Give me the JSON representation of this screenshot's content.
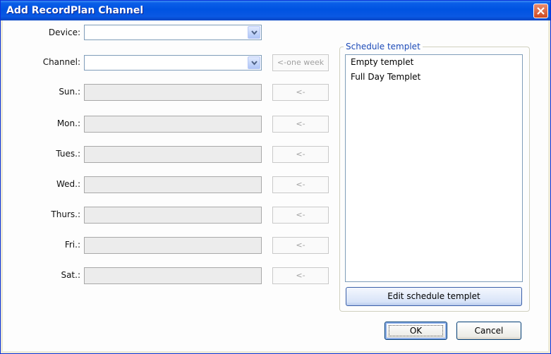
{
  "window": {
    "title": "Add RecordPlan Channel"
  },
  "form": {
    "device_label": "Device:",
    "channel_label": "Channel:",
    "device_value": "",
    "channel_value": "",
    "one_week_button": "<-one week"
  },
  "days": [
    {
      "label": "Sun.:",
      "value": "",
      "button": "<-"
    },
    {
      "label": "Mon.:",
      "value": "",
      "button": "<-"
    },
    {
      "label": "Tues.:",
      "value": "",
      "button": "<-"
    },
    {
      "label": "Wed.:",
      "value": "",
      "button": "<-"
    },
    {
      "label": "Thurs.:",
      "value": "",
      "button": "<-"
    },
    {
      "label": "Fri.:",
      "value": "",
      "button": "<-"
    },
    {
      "label": "Sat.:",
      "value": "",
      "button": "<-"
    }
  ],
  "templates": {
    "title": "Schedule templet",
    "items": [
      "Empty templet",
      "Full Day Templet"
    ],
    "edit_button": "Edit schedule templet"
  },
  "dialog_buttons": {
    "ok": "OK",
    "cancel": "Cancel"
  },
  "colors": {
    "titlebar": "#0053e1",
    "close": "#d04a21",
    "group_title": "#1c4ab8"
  }
}
